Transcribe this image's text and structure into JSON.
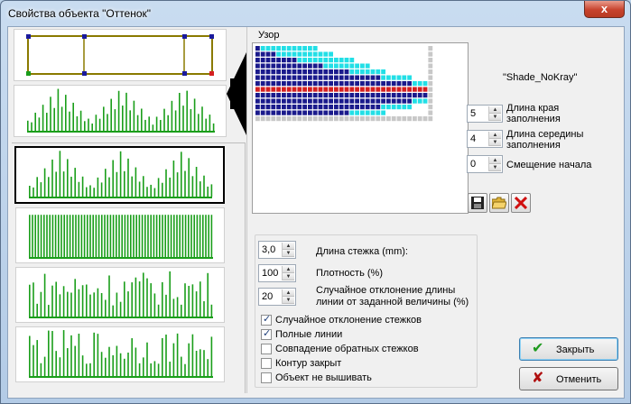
{
  "window": {
    "title": "Свойства объекта \"Оттенок\"",
    "close_glyph": "x"
  },
  "pattern": {
    "label": "Узор",
    "shade_name": "\"Shade_NoKray\""
  },
  "fields": {
    "edge_length": {
      "value": "5",
      "label_line1": "Длина края",
      "label_line2": "заполнения"
    },
    "middle_length": {
      "value": "4",
      "label_line1": "Длина середины",
      "label_line2": "заполнения"
    },
    "start_offset": {
      "value": "0",
      "label": "Смещение начала"
    },
    "stitch_length": {
      "value": "3,0",
      "label": "Длина стежка (mm):"
    },
    "density": {
      "value": "100",
      "label": "Плотность (%)"
    },
    "line_deviation": {
      "value": "20",
      "label_line1": "Случайное отклонение длины",
      "label_line2": "линии от заданной величины (%)"
    }
  },
  "icons": {
    "save": "floppy-disk-icon",
    "open": "folder-open-icon",
    "delete": "red-x-icon"
  },
  "options": [
    {
      "label": "Случайное отклонение стежков",
      "checked": true
    },
    {
      "label": "Полные линии",
      "checked": true
    },
    {
      "label": "Совпадение обратных стежков",
      "checked": false
    },
    {
      "label": "Контур закрыт",
      "checked": false
    },
    {
      "label": "Объект не вышивать",
      "checked": false
    }
  ],
  "buttons": {
    "ok": "Закрыть",
    "cancel": "Отменить"
  },
  "colors": {
    "stitch_green": "#1a9e1a",
    "pattern_navy": "#1a1a8c",
    "pattern_cyan": "#22dfe6",
    "pattern_red": "#d42020",
    "pattern_gray": "#c8c8c8"
  },
  "pattern_rows": [
    [
      [
        "n",
        1
      ],
      [
        "c",
        11
      ],
      [
        "g",
        0
      ]
    ],
    [
      [
        "n",
        4
      ],
      [
        "c",
        11
      ],
      [
        "g",
        0
      ]
    ],
    [
      [
        "n",
        8
      ],
      [
        "c",
        11
      ],
      [
        "g",
        0
      ]
    ],
    [
      [
        "n",
        13
      ],
      [
        "c",
        9
      ],
      [
        "g",
        0
      ]
    ],
    [
      [
        "n",
        18
      ],
      [
        "c",
        7
      ],
      [
        "g",
        0
      ]
    ],
    [
      [
        "n",
        24
      ],
      [
        "c",
        6
      ],
      [
        "g",
        0
      ]
    ],
    [
      [
        "n",
        30
      ],
      [
        "c",
        3
      ],
      [
        "g",
        0
      ]
    ],
    [
      [
        "r",
        33
      ],
      [
        "g",
        0
      ]
    ],
    [
      [
        "n",
        33
      ],
      [
        "g",
        0
      ]
    ],
    [
      [
        "n",
        30
      ],
      [
        "c",
        3
      ],
      [
        "g",
        0
      ]
    ],
    [
      [
        "n",
        24
      ],
      [
        "c",
        6
      ],
      [
        "g",
        0
      ]
    ],
    [
      [
        "n",
        18
      ],
      [
        "c",
        7
      ],
      [
        "g",
        0
      ]
    ],
    [
      [
        "g",
        34
      ]
    ]
  ]
}
